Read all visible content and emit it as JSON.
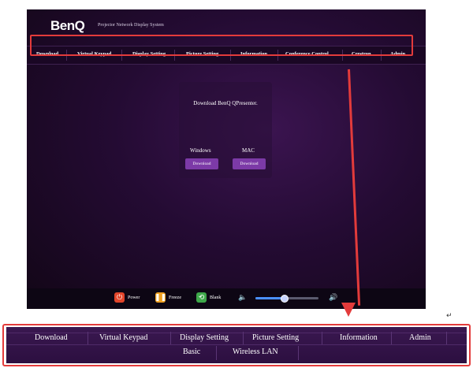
{
  "app": {
    "brand": "BenQ",
    "subtitle": "Projector Network Display System"
  },
  "top_nav": {
    "items": [
      "Download",
      "Virtual Keypad",
      "Display Setting",
      "Picture Setting",
      "Information",
      "Conference Control",
      "Crestron",
      "Admin"
    ]
  },
  "download_panel": {
    "title": "Download BenQ QPresenter.",
    "windows_label": "Windows",
    "mac_label": "MAC",
    "windows_button": "Download",
    "mac_button": "Download"
  },
  "control_bar": {
    "power_label": "Power",
    "freeze_label": "Freeze",
    "blank_label": "Blank",
    "volume_level": 0.45,
    "colors": {
      "power": "#e2452b",
      "freeze": "#f0a020",
      "blank": "#3ea84a"
    }
  },
  "bottom_nav": {
    "row1": [
      "Download",
      "Virtual Keypad",
      "Display Setting",
      "Picture Setting",
      "Information",
      "Admin"
    ],
    "row2": [
      "Basic",
      "Wireless LAN"
    ]
  },
  "annotation": {
    "highlight_color": "#e33b3b",
    "cursor_glyph": "↵"
  }
}
